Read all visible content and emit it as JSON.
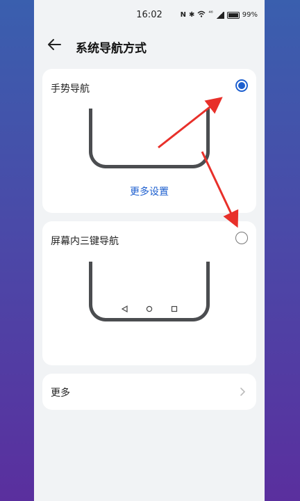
{
  "status_bar": {
    "time": "16:02",
    "battery": "99%",
    "nfc": "N",
    "bt": "✱",
    "wifi_label": "⁴⁶"
  },
  "header": {
    "title": "系统导航方式"
  },
  "options": [
    {
      "label": "手势导航",
      "selected": true,
      "link": "更多设置"
    },
    {
      "label": "屏幕内三键导航",
      "selected": false
    }
  ],
  "more": {
    "label": "更多"
  },
  "colors": {
    "accent": "#1d5fcf",
    "annotation": "#e8302a",
    "frame": "#4b4d50"
  }
}
